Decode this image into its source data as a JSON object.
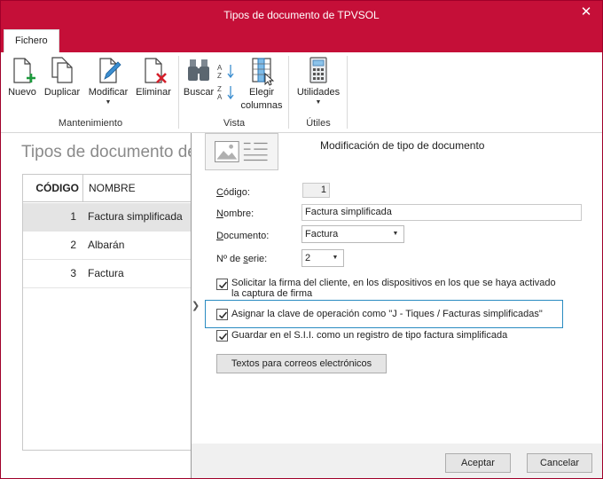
{
  "window": {
    "title": "Tipos de documento de TPVSOL",
    "close_symbol": "✕"
  },
  "ribbon": {
    "tab": "Fichero",
    "groups": {
      "mantenimiento": "Mantenimiento",
      "vista": "Vista",
      "utiles": "Útiles"
    },
    "buttons": {
      "nuevo": "Nuevo",
      "duplicar": "Duplicar",
      "modificar": "Modificar",
      "eliminar": "Eliminar",
      "buscar": "Buscar",
      "elegir_l1": "Elegir",
      "elegir_l2": "columnas",
      "utilidades": "Utilidades"
    }
  },
  "list": {
    "title": "Tipos de documento de",
    "columns": {
      "code": "CÓDIGO",
      "name": "NOMBRE"
    },
    "rows": [
      {
        "code": "1",
        "name": "Factura simplificada",
        "selected": true
      },
      {
        "code": "2",
        "name": "Albarán",
        "selected": false
      },
      {
        "code": "3",
        "name": "Factura",
        "selected": false
      }
    ]
  },
  "dialog": {
    "title": "Modificación de tipo de documento",
    "fields": {
      "codigo": {
        "label_u": "C",
        "label_rest": "ódigo:",
        "value": "1"
      },
      "nombre": {
        "label_u": "N",
        "label_rest": "ombre:",
        "value": "Factura simplificada"
      },
      "documento": {
        "label_u": "D",
        "label_rest": "ocumento:",
        "value": "Factura"
      },
      "serie": {
        "label_pre": "Nº de ",
        "label_u": "s",
        "label_rest": "erie:",
        "value": "2"
      }
    },
    "checks": {
      "firma_l1": "Solicitar la firma del cliente, en los dispositivos en los que se haya activado",
      "firma_l2": "la captura de firma",
      "clave": "Asignar la clave de operación como \"J - Tiques / Facturas simplificadas\"",
      "sii": "Guardar en el S.I.I. como un registro de tipo factura simplificada"
    },
    "textos_button": "Textos para correos electrónicos",
    "accept_button": "Aceptar",
    "cancel_button": "Cancelar"
  },
  "colors": {
    "accent": "#c50f38",
    "highlight_border": "#2a8bc1"
  }
}
